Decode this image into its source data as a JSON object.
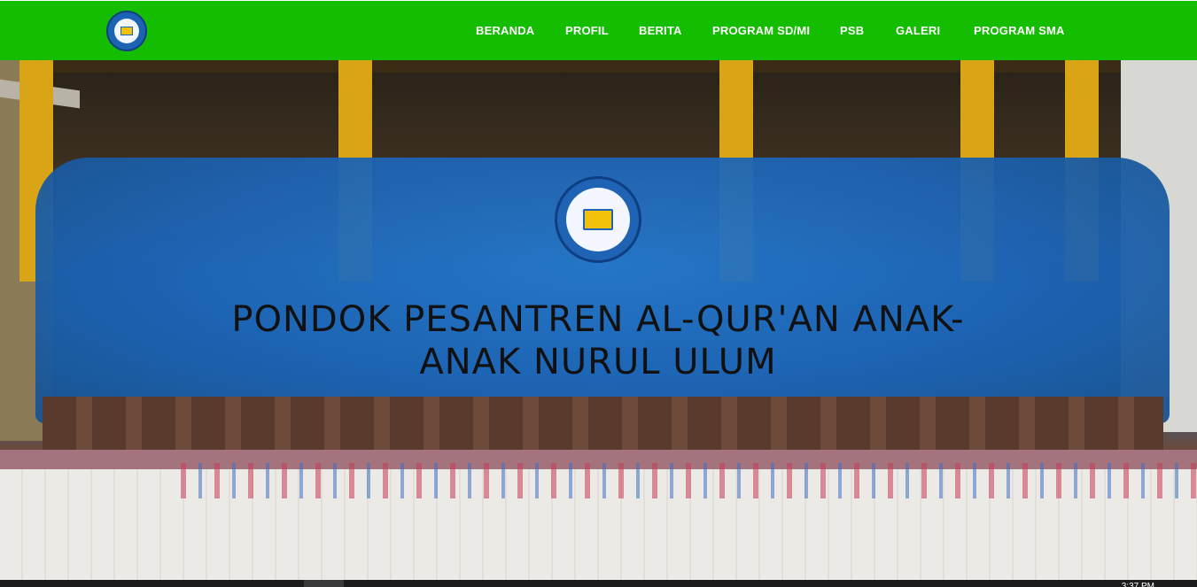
{
  "nav": {
    "items": [
      {
        "label": "BERANDA"
      },
      {
        "label": "PROFIL"
      },
      {
        "label": "BERITA"
      },
      {
        "label": "PROGRAM SD/MI"
      },
      {
        "label": "PSB"
      },
      {
        "label": "GALERI"
      },
      {
        "label": "PROGRAM SMA"
      }
    ],
    "background_color": "#14bd00"
  },
  "hero": {
    "title": "PONDOK PESANTREN AL-QUR'AN ANAK-ANAK NURUL ULUM"
  },
  "taskbar": {
    "clock": "3:37 PM"
  }
}
